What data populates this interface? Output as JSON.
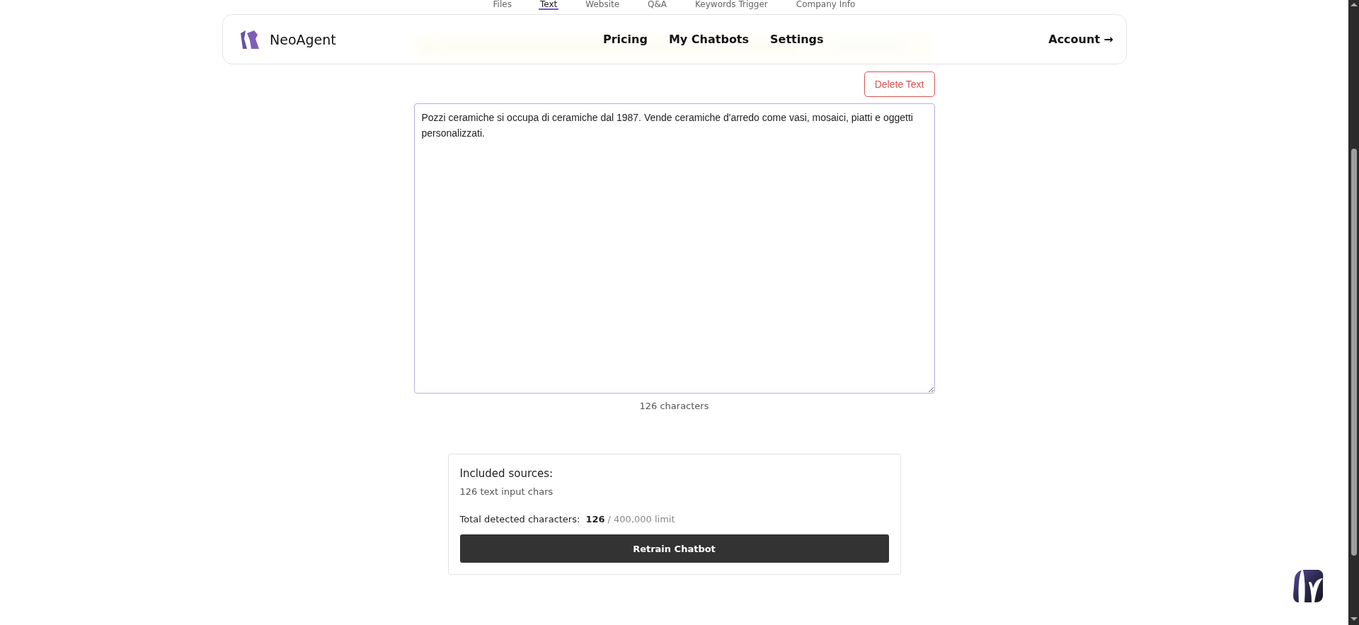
{
  "tabs": [
    {
      "label": "Files",
      "selected": false
    },
    {
      "label": "Text",
      "selected": true
    },
    {
      "label": "Website",
      "selected": false
    },
    {
      "label": "Q&A",
      "selected": false
    },
    {
      "label": "Keywords Trigger",
      "selected": false
    },
    {
      "label": "Company Info",
      "selected": false
    }
  ],
  "header": {
    "brand": "NeoAgent",
    "nav": [
      "Pricing",
      "My Chatbots",
      "Settings"
    ],
    "account": "Account",
    "account_arrow": "→"
  },
  "editor": {
    "delete_button": "Delete Text",
    "text": "Pozzi ceramiche si occupa di ceramiche dal 1987. Vende ceramiche d'arredo come vasi, mosaici, piatti e oggetti personalizzati.",
    "count": "126 characters"
  },
  "summary": {
    "title": "Included sources:",
    "sources": [
      "126 text input chars"
    ],
    "total_label": "Total detected characters:",
    "total_value": "126",
    "total_limit": "/ 400,000 limit",
    "button": "Retrain Chatbot"
  }
}
